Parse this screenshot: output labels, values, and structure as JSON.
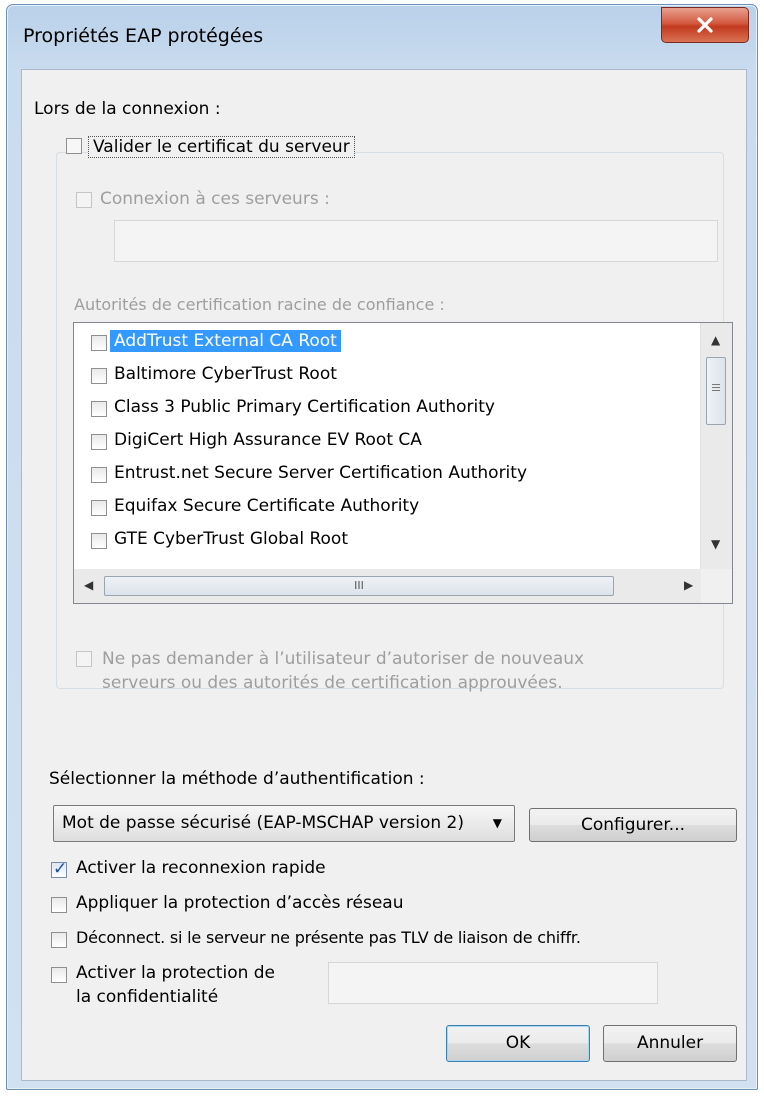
{
  "window": {
    "title": "Propriétés EAP protégées"
  },
  "section_label": "Lors de la connexion :",
  "validate_cert": {
    "label": "Valider le certificat du serveur",
    "checked": false
  },
  "connect_servers": {
    "label": "Connexion à ces serveurs :",
    "checked": false,
    "value": ""
  },
  "root_ca": {
    "label": "Autorités de certification racine de confiance :",
    "items": [
      {
        "label": "AddTrust External CA Root",
        "checked": false,
        "selected": true
      },
      {
        "label": "Baltimore CyberTrust Root",
        "checked": false
      },
      {
        "label": "Class 3 Public Primary Certification Authority",
        "checked": false
      },
      {
        "label": "DigiCert High Assurance EV Root CA",
        "checked": false
      },
      {
        "label": "Entrust.net Secure Server Certification Authority",
        "checked": false
      },
      {
        "label": "Equifax Secure Certificate Authority",
        "checked": false
      },
      {
        "label": "GTE CyberTrust Global Root",
        "checked": false
      }
    ],
    "hscroll_grip": "III"
  },
  "no_prompt": {
    "line1": "Ne pas demander à l’utilisateur d’autoriser de nouveaux",
    "line2": "serveurs ou des autorités de certification approuvées.",
    "checked": false
  },
  "auth_method": {
    "label": "Sélectionner la méthode d’authentification :",
    "selected": "Mot de passe sécurisé (EAP-MSCHAP version 2)",
    "configure_label": "Configurer..."
  },
  "options": {
    "fast_reconnect": {
      "label": "Activer la reconnexion rapide",
      "checked": true
    },
    "nap": {
      "label": "Appliquer la protection d’accès réseau",
      "checked": false
    },
    "disconnect_tlv": {
      "label": "Déconnect. si le serveur ne présente pas TLV de liaison de chiffr.",
      "checked": false
    },
    "privacy": {
      "line1": "Activer la protection de",
      "line2": "la confidentialité",
      "checked": false,
      "value": ""
    }
  },
  "buttons": {
    "ok": "OK",
    "cancel": "Annuler"
  }
}
